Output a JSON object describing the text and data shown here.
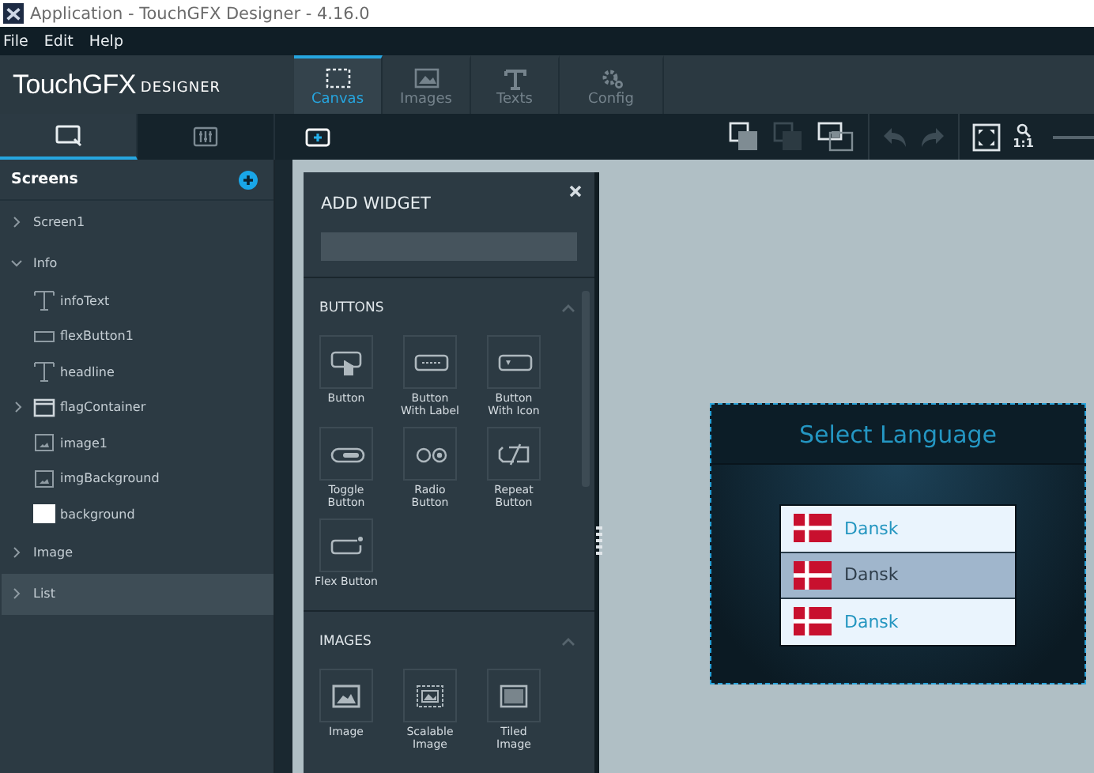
{
  "window": {
    "title": "Application - TouchGFX Designer - 4.16.0"
  },
  "menu": [
    "File",
    "Edit",
    "Help"
  ],
  "logo": {
    "brand": "TouchGFX",
    "sub": "DESIGNER"
  },
  "tabs": [
    {
      "label": "Canvas",
      "kind": "canvas",
      "selected": true
    },
    {
      "label": "Images",
      "kind": "images",
      "selected": false
    },
    {
      "label": "Texts",
      "kind": "texts",
      "selected": false
    },
    {
      "label": "Config",
      "kind": "config",
      "selected": false
    }
  ],
  "panel_tabs": [
    {
      "kind": "screens",
      "selected": true
    },
    {
      "kind": "properties",
      "selected": false
    }
  ],
  "toolbar": {
    "zoom_label": "1:1"
  },
  "screens_panel": {
    "title": "Screens"
  },
  "screens": [
    {
      "label": "Screen1",
      "expanded": false,
      "selected": false
    },
    {
      "label": "Info",
      "expanded": true,
      "selected": false,
      "children": [
        {
          "label": "infoText",
          "kind": "text"
        },
        {
          "label": "flexButton1",
          "kind": "flexbutton"
        },
        {
          "label": "headline",
          "kind": "text"
        },
        {
          "label": "flagContainer",
          "kind": "container",
          "expanded": false
        },
        {
          "label": "image1",
          "kind": "image"
        },
        {
          "label": "imgBackground",
          "kind": "image"
        },
        {
          "label": "background",
          "kind": "box"
        }
      ]
    },
    {
      "label": "Image",
      "expanded": false,
      "selected": false
    },
    {
      "label": "List",
      "expanded": false,
      "selected": true
    }
  ],
  "add_widget": {
    "title": "ADD WIDGET",
    "sections": [
      {
        "title": "BUTTONS",
        "expanded": true,
        "items": [
          {
            "label": "Button",
            "kind": "button"
          },
          {
            "label": "Button\nWith Label",
            "kind": "label"
          },
          {
            "label": "Button\nWith Icon",
            "kind": "icon"
          },
          {
            "label": "Toggle\nButton",
            "kind": "toggle"
          },
          {
            "label": "Radio\nButton",
            "kind": "radio"
          },
          {
            "label": "Repeat\nButton",
            "kind": "repeat"
          },
          {
            "label": "Flex Button",
            "kind": "flex"
          }
        ]
      },
      {
        "title": "IMAGES",
        "expanded": true,
        "items": [
          {
            "label": "Image",
            "kind": "image"
          },
          {
            "label": "Scalable\nImage",
            "kind": "scalable"
          },
          {
            "label": "Tiled\nImage",
            "kind": "tiled"
          }
        ]
      }
    ]
  },
  "preview": {
    "title": "Select Language",
    "rows": [
      {
        "label": "Dansk",
        "selected": false
      },
      {
        "label": "Dansk",
        "selected": true
      },
      {
        "label": "Dansk",
        "selected": false
      }
    ]
  }
}
